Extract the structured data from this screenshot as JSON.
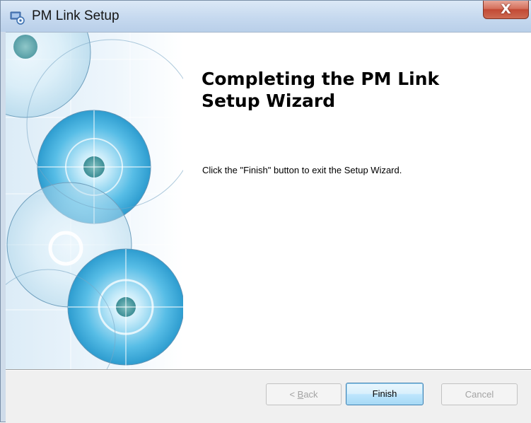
{
  "window": {
    "title": "PM Link Setup",
    "close_symbol": "X",
    "app_icon": "installer-icon"
  },
  "content": {
    "heading_line1": "Completing the PM Link",
    "heading_line2": "Setup Wizard",
    "message": "Click the \"Finish\" button to exit the Setup Wizard."
  },
  "buttons": {
    "back_prefix": "< ",
    "back_access_key": "B",
    "back_rest": "ack",
    "back_enabled": false,
    "finish_label": "Finish",
    "finish_enabled": true,
    "cancel_label": "Cancel",
    "cancel_enabled": false
  },
  "colors": {
    "title_bar": "#c6d9ef",
    "close_button": "#c24a35",
    "button_bar": "#f0f0f0",
    "default_button_border": "#3c7fb1",
    "artwork_blue": "#4fb3de"
  }
}
